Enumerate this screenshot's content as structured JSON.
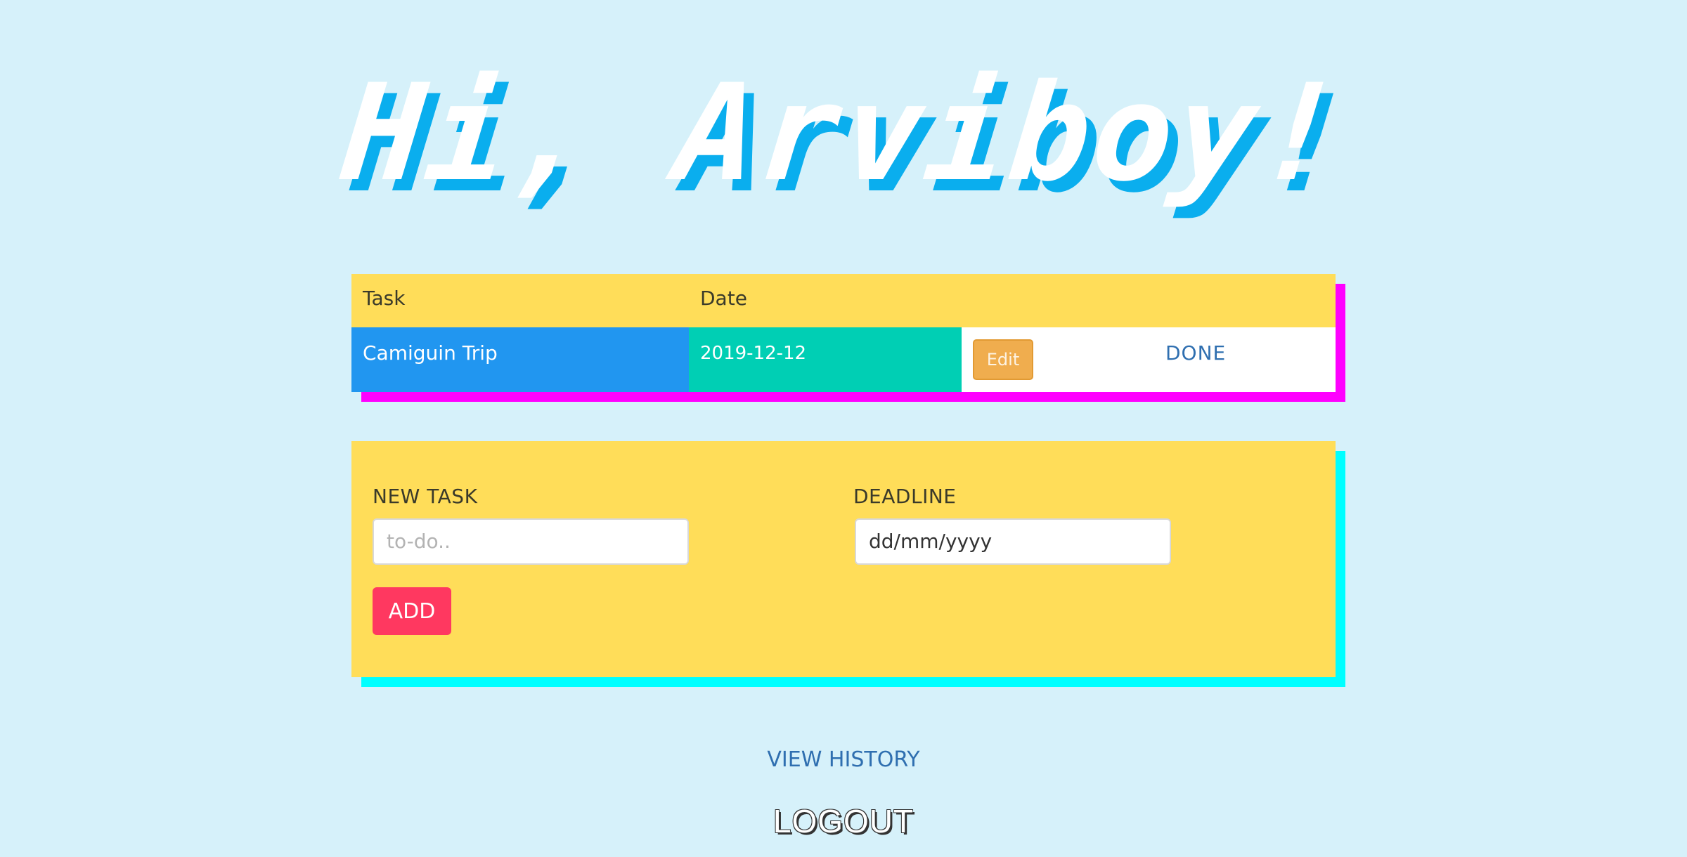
{
  "greeting": {
    "text": "Hi, Arviboy!"
  },
  "tasks_table": {
    "headers": {
      "task": "Task",
      "date": "Date"
    },
    "rows": [
      {
        "task": "Camiguin Trip",
        "date": "2019-12-12",
        "edit_label": "Edit",
        "done_label": "DONE"
      }
    ]
  },
  "new_task_form": {
    "task_label": "NEW TASK",
    "task_placeholder": "to-do..",
    "deadline_label": "DEADLINE",
    "deadline_value": "dd/mm/yyyy",
    "add_label": "ADD"
  },
  "footer": {
    "history_label": "VIEW HISTORY",
    "logout_label": "LOGOUT"
  },
  "colors": {
    "background": "#d6f1fa",
    "greeting_shadow": "#0aaeee",
    "table_header": "#ffdd59",
    "task_cell": "#2196f0",
    "date_cell": "#00cfb4",
    "table_shadow": "#ff00ff",
    "form_shadow": "#00ffff",
    "add_button": "#ff3860",
    "edit_button": "#f0ad4e",
    "link": "#2f6fb0"
  }
}
